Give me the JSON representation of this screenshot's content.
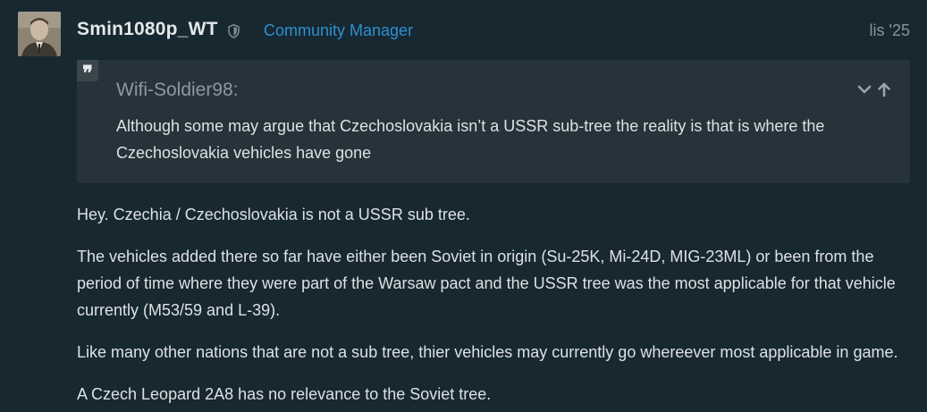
{
  "post": {
    "username": "Smin1080p_WT",
    "user_title": "Community Manager",
    "date": "lis '25",
    "icons": {
      "avatar": "avatar",
      "badge": "shield-icon",
      "quote_mark": "quote-icon",
      "expand": "chevron-down-icon",
      "go_to": "arrow-up-icon"
    },
    "quote": {
      "author": "Wifi-Soldier98:",
      "mark": "❞",
      "text": "Although some may argue that Czechoslovakia isn’t a USSR sub-tree the reality is that is where the Czechoslovakia vehicles have gone"
    },
    "paragraphs": [
      "Hey. Czechia / Czechoslovakia is not a USSR sub tree.",
      "The vehicles added there so far have either been Soviet in origin (Su-25K, Mi-24D, MIG-23ML) or been from the period of time where they were part of the Warsaw pact and the USSR tree was the most applicable for that vehicle currently (M53/59 and L-39).",
      "Like many other nations that are not a sub tree, thier vehicles may currently go whereever most applicable in game.",
      "A Czech Leopard 2A8 has no relevance to the Soviet tree."
    ]
  },
  "colors": {
    "background": "#172831",
    "quote_background": "#26333a",
    "title_blue": "#2e8fd0",
    "muted": "#8a949a",
    "text": "#dde1e4"
  }
}
